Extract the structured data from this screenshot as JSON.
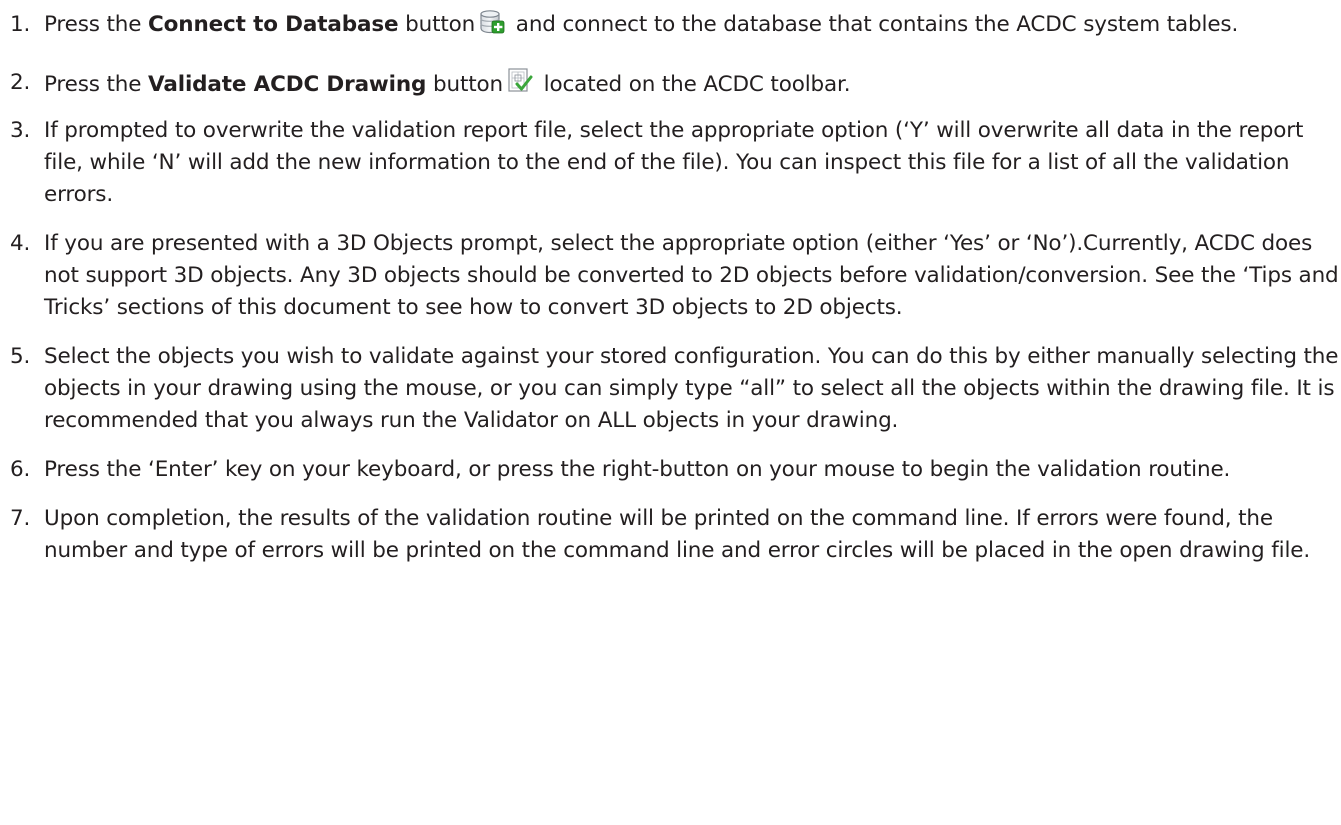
{
  "steps": [
    {
      "num": "1.",
      "pre": "Press the ",
      "bold": "Connect to Database",
      "mid": " button",
      "icon": "database-add-icon",
      "post": " and connect to the database that contains the ACDC system tables."
    },
    {
      "num": "2.",
      "pre": "Press the ",
      "bold": "Validate ACDC Drawing",
      "mid": " button",
      "icon": "validate-drawing-icon",
      "post": " located on the ACDC toolbar."
    },
    {
      "num": "3.",
      "text": "If prompted to overwrite the validation report file, select the appropriate option (‘Y’ will overwrite all data in the report file, while ‘N’ will add the new information to the end of the file). You can inspect this file for a list of all the validation errors."
    },
    {
      "num": "4.",
      "text": "If you are presented with a 3D Objects prompt, select the appropriate option (either ‘Yes’ or ‘No’).Currently, ACDC does not support 3D objects. Any 3D objects should be converted to 2D objects before validation/conversion. See the ‘Tips and Tricks’ sections of this document to see how to convert 3D objects to 2D objects."
    },
    {
      "num": "5.",
      "text": "Select the objects you wish to validate against your stored configuration. You can do this by either manually selecting the objects in your drawing using the mouse, or you can simply type “all” to select all the objects within the drawing file. It is recommended that you always run the Validator on ALL objects in your drawing."
    },
    {
      "num": "6.",
      "text": "Press the ‘Enter’ key on your keyboard, or press the right-button on your mouse to begin the validation routine."
    },
    {
      "num": "7.",
      "text": "Upon completion, the results of the validation routine will be printed on the command line. If errors were found, the number and type of errors will be printed on the command line and error circles will be placed in the open drawing file."
    }
  ]
}
